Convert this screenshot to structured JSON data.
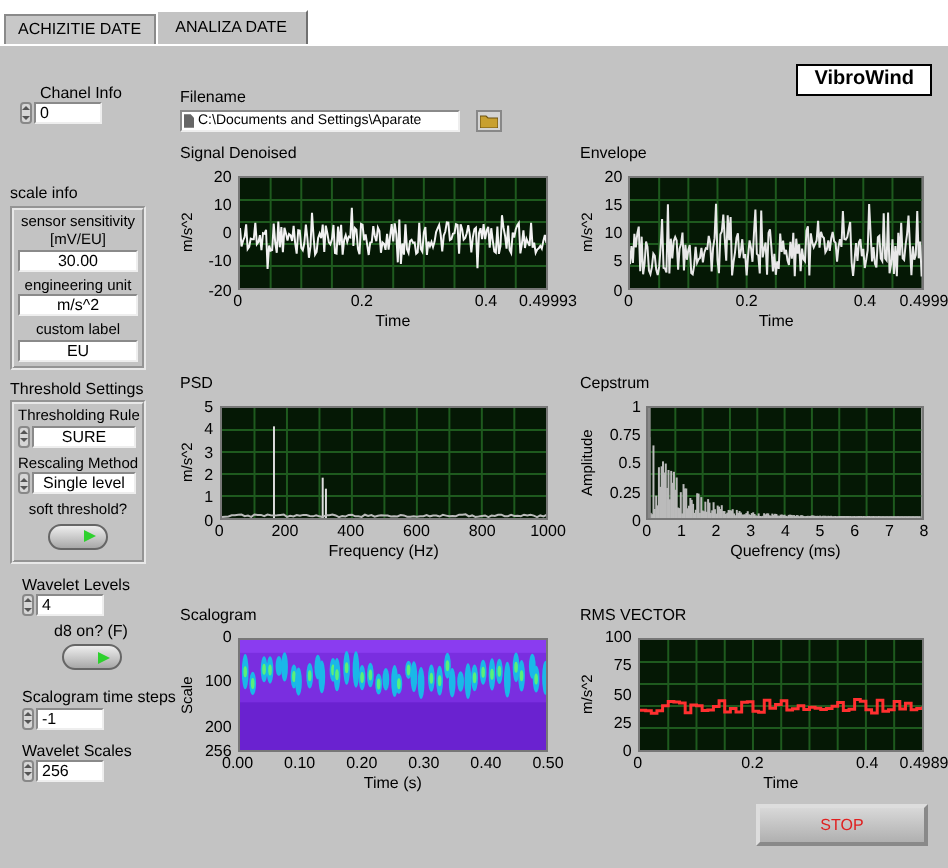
{
  "tabs": [
    {
      "label": "ACHIZITIE DATE",
      "selected": false
    },
    {
      "label": "ANALIZA DATE",
      "selected": true
    }
  ],
  "brand": "VibroWind",
  "channel": {
    "label": "Chanel Info",
    "value": "0"
  },
  "filename": {
    "label": "Filename",
    "value": "C:\\Documents and Settings\\Aparate"
  },
  "scale_info": {
    "label": "scale info",
    "fields": [
      {
        "label": "sensor sensitivity [mV/EU]",
        "value": "30.00"
      },
      {
        "label": "engineering unit",
        "value": "m/s^2"
      },
      {
        "label": "custom label",
        "value": "EU"
      }
    ]
  },
  "threshold_settings": {
    "label": "Threshold Settings",
    "items": [
      {
        "kind": "ring",
        "label": "Thresholding Rule",
        "value": "SURE"
      },
      {
        "kind": "ring",
        "label": "Rescaling Method",
        "value": "Single level"
      },
      {
        "kind": "switch",
        "label": "soft threshold?",
        "on": true
      }
    ]
  },
  "controls": [
    {
      "kind": "numeric",
      "label": "Wavelet Levels",
      "value": "4"
    },
    {
      "kind": "switch",
      "label": "d8 on? (F)",
      "on": true
    },
    {
      "kind": "numeric",
      "label": "Scalogram time steps",
      "value": "-1"
    },
    {
      "kind": "numeric",
      "label": "Wavelet Scales",
      "value": "256"
    }
  ],
  "graphs": [
    {
      "title": "Signal Denoised",
      "kind": "noise",
      "ylabel": "m/s^2",
      "yticks": [
        "20",
        "10",
        "0",
        "-10",
        "-20"
      ],
      "xticks": [
        "0",
        "0.2",
        "0.4",
        "0.49993"
      ],
      "xlabel": "Time"
    },
    {
      "title": "Envelope",
      "kind": "envelope",
      "ylabel": "m/s^2",
      "yticks": [
        "20",
        "15",
        "10",
        "5",
        "0"
      ],
      "xticks": [
        "0",
        "0.2",
        "0.4",
        "0.4999"
      ],
      "xlabel": "Time"
    },
    {
      "title": "PSD",
      "kind": "spectrum",
      "ylabel": "m/s^2",
      "yticks": [
        "5",
        "4",
        "3",
        "2",
        "1",
        "0"
      ],
      "xticks": [
        "0",
        "200",
        "400",
        "600",
        "800",
        "1000"
      ],
      "xlabel": "Frequency (Hz)"
    },
    {
      "title": "Cepstrum",
      "kind": "decay",
      "ylabel": "Amplitude",
      "yticks": [
        "1",
        "0.75",
        "0.5",
        "0.25",
        "0"
      ],
      "xticks": [
        "0",
        "1",
        "2",
        "3",
        "4",
        "5",
        "6",
        "7",
        "8"
      ],
      "xlabel": "Quefrency (ms)"
    },
    {
      "title": "Scalogram",
      "kind": "scalogram",
      "ylabel": "Scale",
      "yticks": [
        "0",
        "100",
        "200",
        "256"
      ],
      "xticks": [
        "0.00",
        "0.10",
        "0.20",
        "0.30",
        "0.40",
        "0.50"
      ],
      "xlabel": "Time (s)"
    },
    {
      "title": "RMS VECTOR",
      "kind": "step",
      "ylabel": "m/s^2",
      "yticks": [
        "100",
        "75",
        "50",
        "25",
        "0"
      ],
      "xticks": [
        "0",
        "0.2",
        "0.4",
        "0.4989"
      ],
      "xlabel": "Time"
    }
  ],
  "stop_button": "STOP"
}
